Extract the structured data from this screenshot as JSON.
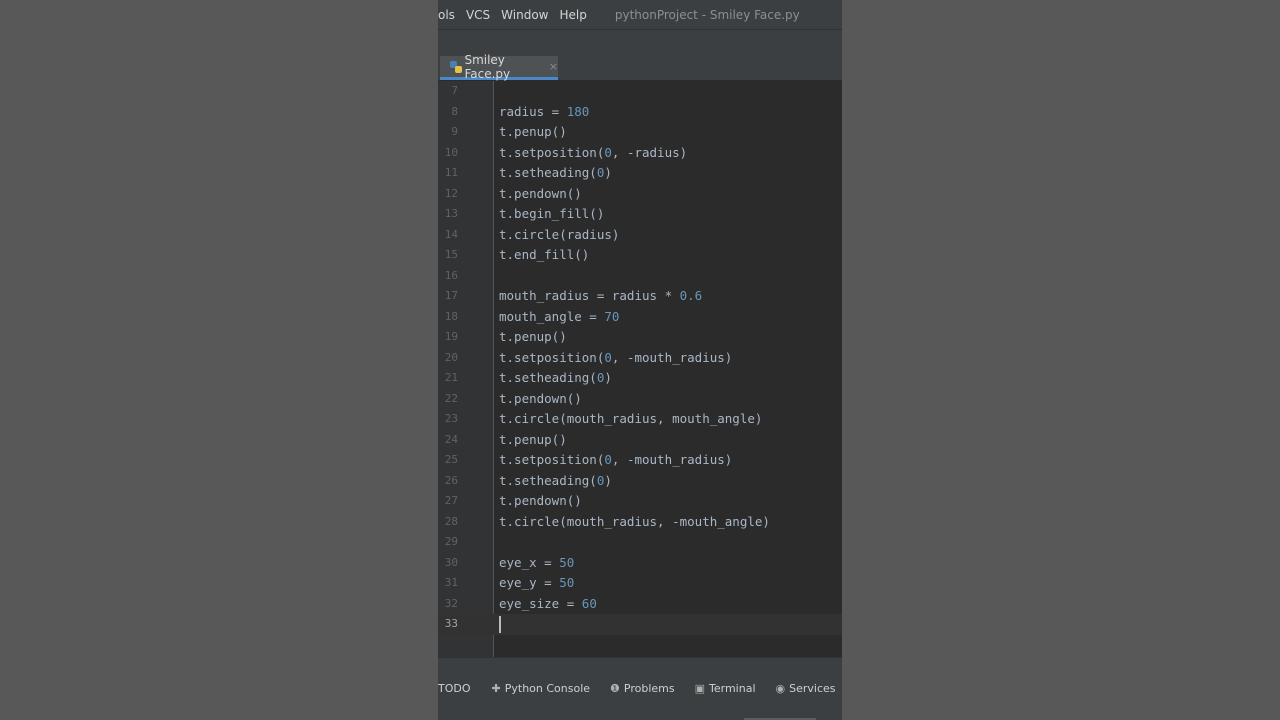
{
  "menubar": {
    "items": [
      "ols",
      "VCS",
      "Window",
      "Help"
    ],
    "window_title": "pythonProject - Smiley Face.py"
  },
  "tab": {
    "filename": "Smiley Face.py",
    "close": "×"
  },
  "editor": {
    "current_line": 33,
    "lines": [
      {
        "n": "7",
        "code": ""
      },
      {
        "n": "8",
        "code": "radius = 180"
      },
      {
        "n": "9",
        "code": "t.penup()"
      },
      {
        "n": "10",
        "code": "t.setposition(0, -radius)"
      },
      {
        "n": "11",
        "code": "t.setheading(0)"
      },
      {
        "n": "12",
        "code": "t.pendown()"
      },
      {
        "n": "13",
        "code": "t.begin_fill()"
      },
      {
        "n": "14",
        "code": "t.circle(radius)"
      },
      {
        "n": "15",
        "code": "t.end_fill()"
      },
      {
        "n": "16",
        "code": ""
      },
      {
        "n": "17",
        "code": "mouth_radius = radius * 0.6"
      },
      {
        "n": "18",
        "code": "mouth_angle = 70"
      },
      {
        "n": "19",
        "code": "t.penup()"
      },
      {
        "n": "20",
        "code": "t.setposition(0, -mouth_radius)"
      },
      {
        "n": "21",
        "code": "t.setheading(0)"
      },
      {
        "n": "22",
        "code": "t.pendown()"
      },
      {
        "n": "23",
        "code": "t.circle(mouth_radius, mouth_angle)"
      },
      {
        "n": "24",
        "code": "t.penup()"
      },
      {
        "n": "25",
        "code": "t.setposition(0, -mouth_radius)"
      },
      {
        "n": "26",
        "code": "t.setheading(0)"
      },
      {
        "n": "27",
        "code": "t.pendown()"
      },
      {
        "n": "28",
        "code": "t.circle(mouth_radius, -mouth_angle)"
      },
      {
        "n": "29",
        "code": ""
      },
      {
        "n": "30",
        "code": "eye_x = 50"
      },
      {
        "n": "31",
        "code": "eye_y = 50"
      },
      {
        "n": "32",
        "code": "eye_size = 60"
      },
      {
        "n": "33",
        "code": ""
      }
    ]
  },
  "toolwindows": {
    "todo": "TODO",
    "python_console": "Python Console",
    "problems": "Problems",
    "terminal": "Terminal",
    "services": "Services"
  },
  "icons": {
    "python_console": "python-console-icon",
    "problems": "problems-icon",
    "terminal": "terminal-icon",
    "services": "services-icon",
    "file": "python-file-icon"
  },
  "colors": {
    "editor_bg": "#2b2b2b",
    "default_text": "#a9b7c6",
    "number": "#6897bb",
    "tab_underline": "#4a88c7"
  }
}
